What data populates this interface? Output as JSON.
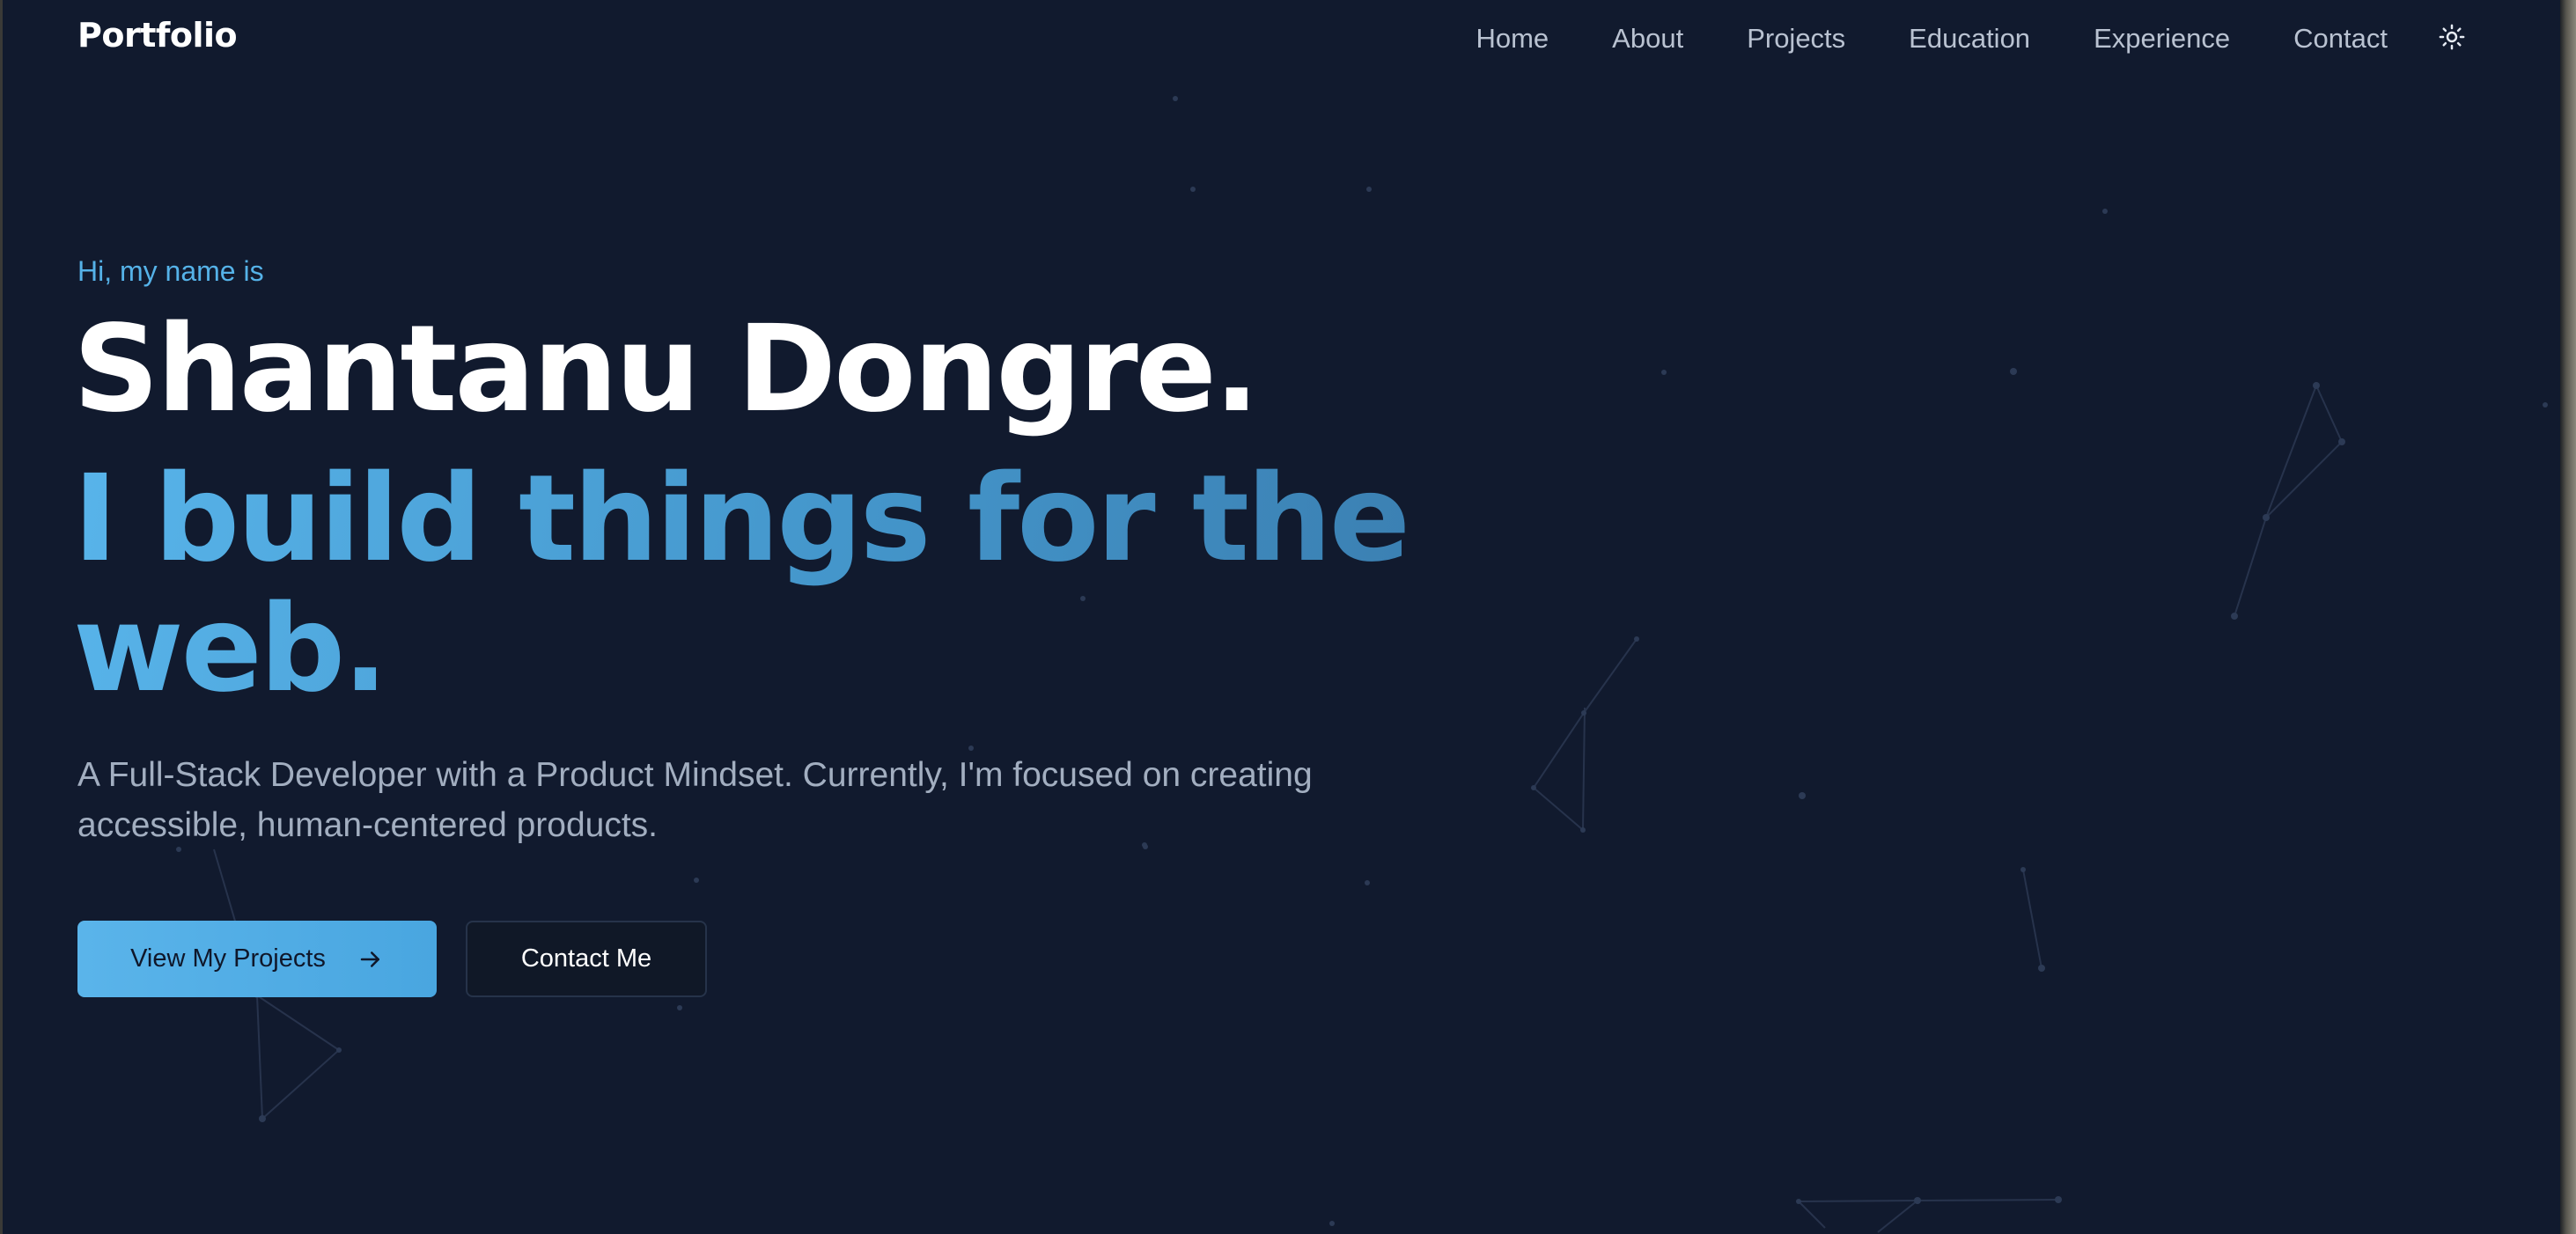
{
  "brand": "Portfolio",
  "nav": {
    "items": [
      "Home",
      "About",
      "Projects",
      "Education",
      "Experience",
      "Contact"
    ],
    "theme_toggle_icon": "sun-icon"
  },
  "hero": {
    "intro": "Hi, my name is",
    "name": "Shantanu Dongre.",
    "tagline": "I build things for the web.",
    "description": "A Full-Stack Developer with a Product Mindset. Currently, I'm focused on creating accessible, human-centered products.",
    "primary_button": {
      "label": "View My Projects",
      "icon": "arrow-right-icon"
    },
    "secondary_button": {
      "label": "Contact Me"
    }
  },
  "colors": {
    "background": "#111a2e",
    "accent": "#55b2e8",
    "text_primary": "#ffffff",
    "text_muted": "#a2aec0"
  }
}
